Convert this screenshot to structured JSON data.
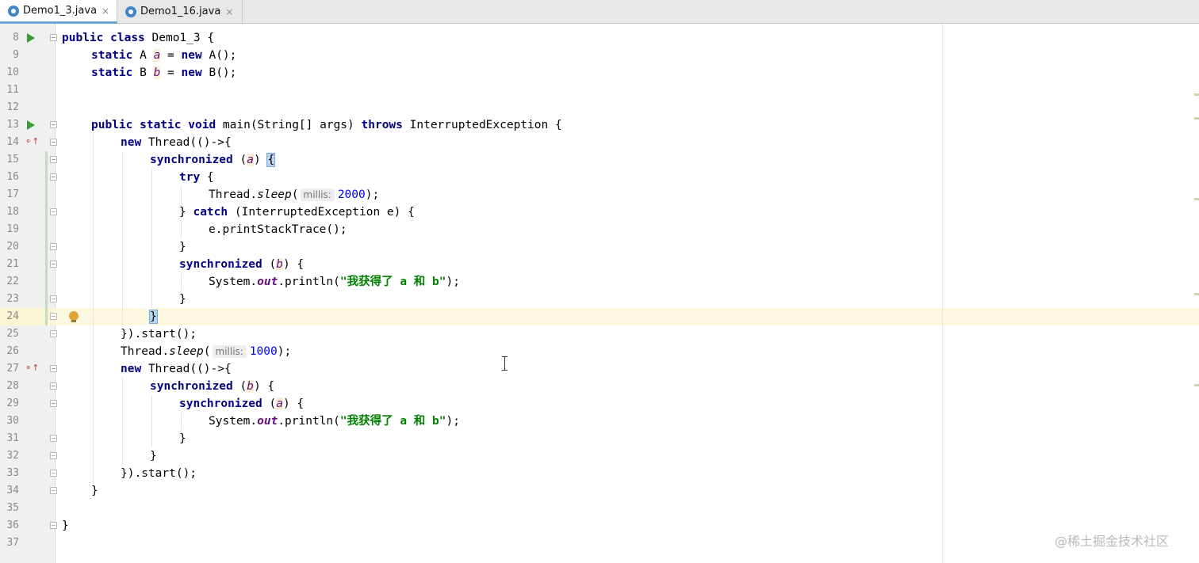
{
  "tabs": [
    {
      "label": "Demo1_3.java",
      "close": "×"
    },
    {
      "label": "Demo1_16.java",
      "close": "×"
    }
  ],
  "editor": {
    "lines": [
      {
        "n": "8"
      },
      {
        "n": "9"
      },
      {
        "n": "10"
      },
      {
        "n": "11"
      },
      {
        "n": "12"
      },
      {
        "n": "13"
      },
      {
        "n": "14"
      },
      {
        "n": "15"
      },
      {
        "n": "16"
      },
      {
        "n": "17"
      },
      {
        "n": "18"
      },
      {
        "n": "19"
      },
      {
        "n": "20"
      },
      {
        "n": "21"
      },
      {
        "n": "22"
      },
      {
        "n": "23"
      },
      {
        "n": "24"
      },
      {
        "n": "25"
      },
      {
        "n": "26"
      },
      {
        "n": "27"
      },
      {
        "n": "28"
      },
      {
        "n": "29"
      },
      {
        "n": "30"
      },
      {
        "n": "31"
      },
      {
        "n": "32"
      },
      {
        "n": "33"
      },
      {
        "n": "34"
      },
      {
        "n": "35"
      },
      {
        "n": "36"
      },
      {
        "n": "37"
      }
    ],
    "tokens": {
      "public": "public",
      "class": "class",
      "static": "static",
      "new": "new",
      "void": "void",
      "throws": "throws",
      "synchronized": "synchronized",
      "try": "try",
      "catch": "catch",
      "class_name": "Demo1_3",
      "field_a": "a",
      "field_b": "b",
      "type_a": "A",
      "type_b": "B",
      "ctor_a": "A();",
      "ctor_b": "B();",
      "main_sig": "main(String[] args)",
      "exception": "InterruptedException",
      "thread_lambda": "Thread(()->{",
      "thread_cls": "Thread.",
      "sleep": "sleep",
      "hint_millis": "millis:",
      "sleep_2000": "2000",
      "sleep_1000": "1000",
      "catch_clause": "(InterruptedException e) {",
      "print_trace": "e.printStackTrace();",
      "system_out": "System.",
      "out": "out",
      "println": ".println(",
      "message": "\"我获得了 a 和 b\"",
      "start": "}).start();"
    }
  },
  "watermark": "@稀土掘金技术社区",
  "colors": {
    "keyword": "#000080",
    "field": "#660e7a",
    "number": "#0000ff",
    "string": "#008000",
    "gutter": "#f0f0f0",
    "current_line": "#fdf9e1"
  }
}
